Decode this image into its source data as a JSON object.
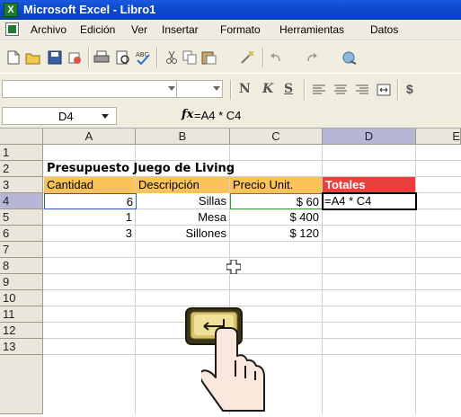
{
  "window": {
    "title": "Microsoft Excel - Libro1"
  },
  "menu": [
    {
      "label": "Archivo"
    },
    {
      "label": "Edición"
    },
    {
      "label": "Ver"
    },
    {
      "label": "Insertar"
    },
    {
      "label": "Formato"
    },
    {
      "label": "Herramientas"
    },
    {
      "label": "Datos"
    }
  ],
  "toolbar": {
    "icons": [
      "new-icon",
      "open-icon",
      "save-icon",
      "permissions-icon",
      "print-icon",
      "print-preview-icon",
      "spelling-icon",
      "cut-icon",
      "copy-icon",
      "paste-icon",
      "format-painter-icon",
      "undo-icon",
      "redo-icon",
      "hyperlink-icon"
    ],
    "format_icons": [
      "bold-icon",
      "italic-icon",
      "underline-icon",
      "align-left-icon",
      "align-center-icon",
      "align-right-icon",
      "merge-center-icon",
      "currency-icon"
    ],
    "bold_label": "N",
    "italic_label": "K",
    "underline_label": "S",
    "currency_label": "$"
  },
  "formula_bar": {
    "name_box": "D4",
    "fx_label": "fx",
    "formula": "=A4 * C4"
  },
  "sheet": {
    "columns": [
      "A",
      "B",
      "C",
      "D",
      "E"
    ],
    "selected_column": "D",
    "rows": [
      "1",
      "2",
      "3",
      "4",
      "5",
      "6",
      "7",
      "8",
      "9",
      "10",
      "11",
      "12",
      "13"
    ],
    "selected_row": "4",
    "cells": {
      "A2": "Presupuesto Juego de Living",
      "A3": "Cantidad",
      "B3": "Descripción",
      "C3": "Precio Unit.",
      "D3": "Totales",
      "A4": "6",
      "B4": "Sillas",
      "C4": "$ 60",
      "D4": "=A4 * C4",
      "A5": "1",
      "B5": "Mesa",
      "C5": "$ 400",
      "A6": "3",
      "B6": "Sillones",
      "C6": "$ 120"
    }
  },
  "overlay": {
    "key_icon": "enter-key-icon",
    "hand_icon": "pressing-hand-icon"
  },
  "colors": {
    "header_fill": "#fbc35a",
    "totals_fill": "#e8413c",
    "title_bar": "#0b47c9"
  }
}
